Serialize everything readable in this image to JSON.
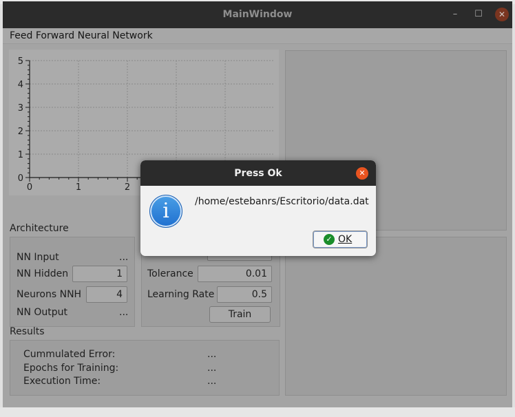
{
  "window": {
    "title": "MainWindow",
    "minimize_glyph": "–",
    "maximize_glyph": "☐",
    "close_glyph": "✕"
  },
  "menubar": {
    "title": "Feed Forward Neural Network"
  },
  "chart_data": {
    "type": "line",
    "title": "",
    "xlabel": "",
    "ylabel": "",
    "xlim": [
      0,
      4
    ],
    "ylim": [
      0,
      5
    ],
    "x_ticks_visible": [
      "0",
      "1",
      "2"
    ],
    "y_ticks": [
      "0",
      "1",
      "2",
      "3",
      "4",
      "5"
    ],
    "grid": true,
    "series": []
  },
  "architecture": {
    "heading": "Architecture",
    "nn_input_label": "NN Input",
    "nn_input_value": "...",
    "nn_hidden_label": "NN Hidden",
    "nn_hidden_value": "1",
    "neurons_nnh_label": "Neurons NNH",
    "neurons_nnh_value": "4",
    "nn_output_label": "NN Output",
    "nn_output_value": "..."
  },
  "training": {
    "tolerance_label": "Tolerance",
    "tolerance_value": "0.01",
    "learning_rate_label": "Learning Rate",
    "learning_rate_value": "0.5",
    "train_button": "Train"
  },
  "results": {
    "heading": "Results",
    "cumulated_error_label": "Cummulated Error:",
    "cumulated_error_value": "...",
    "epochs_label": "Epochs for Training:",
    "epochs_value": "...",
    "execution_time_label": "Execution Time:",
    "execution_time_value": "..."
  },
  "dialog": {
    "title": "Press Ok",
    "close_glyph": "✕",
    "icon_glyph": "i",
    "message": "/home/estebanrs/Escritorio/data.dat",
    "ok_label": "OK",
    "ok_glyph": "✓"
  }
}
